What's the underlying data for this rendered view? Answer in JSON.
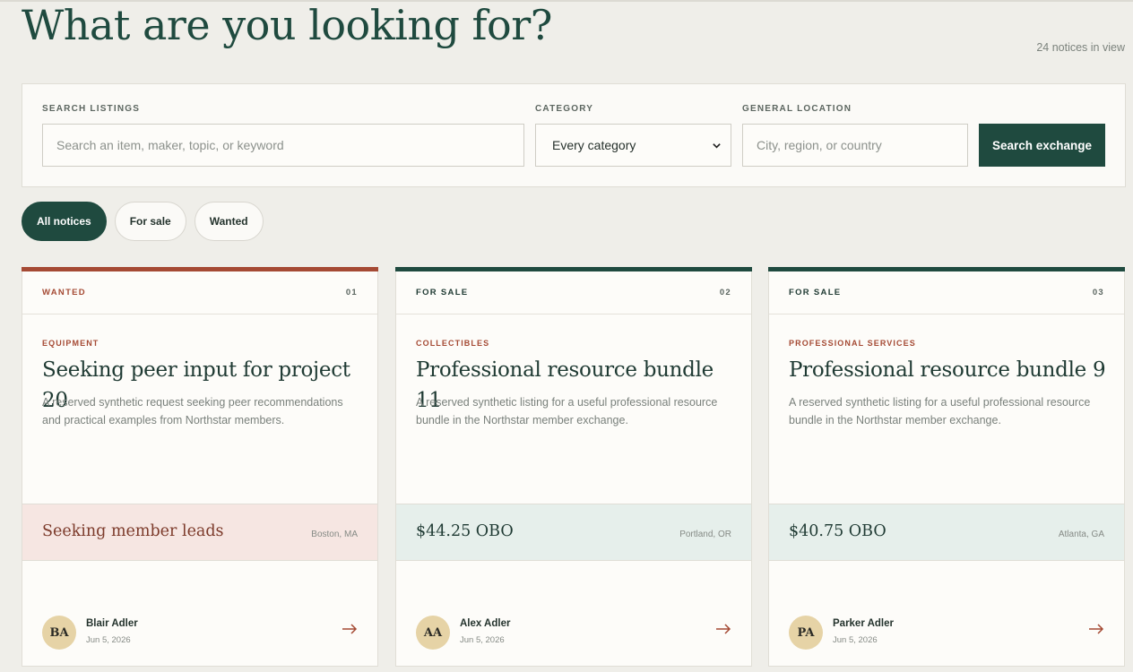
{
  "page": {
    "title": "What are you looking for?",
    "notice_count": "24 notices in view"
  },
  "search": {
    "keyword_label": "SEARCH LISTINGS",
    "keyword_placeholder": "Search an item, maker, topic, or keyword",
    "category_label": "CATEGORY",
    "category_value": "Every category",
    "location_label": "GENERAL LOCATION",
    "location_placeholder": "City, region, or country",
    "button_label": "Search exchange"
  },
  "filters": [
    {
      "label": "All notices",
      "active": true
    },
    {
      "label": "For sale",
      "active": false
    },
    {
      "label": "Wanted",
      "active": false
    }
  ],
  "cards": [
    {
      "type": "WANTED",
      "number": "01",
      "category": "EQUIPMENT",
      "title": "Seeking peer input for project 20",
      "description": "A reserved synthetic request seeking peer recommendations and practical examples from Northstar members.",
      "price": "Seeking member leads",
      "location": "Boston, MA",
      "initials": "BA",
      "author": "Blair Adler",
      "date": "Jun 5, 2026"
    },
    {
      "type": "FOR SALE",
      "number": "02",
      "category": "COLLECTIBLES",
      "title": "Professional resource bundle 11",
      "description": "A reserved synthetic listing for a useful professional resource bundle in the Northstar member exchange.",
      "price": "$44.25 OBO",
      "location": "Portland, OR",
      "initials": "AA",
      "author": "Alex Adler",
      "date": "Jun 5, 2026"
    },
    {
      "type": "FOR SALE",
      "number": "03",
      "category": "PROFESSIONAL SERVICES",
      "title": "Professional resource bundle 9",
      "description": "A reserved synthetic listing for a useful professional resource bundle in the Northstar member exchange.",
      "price": "$40.75 OBO",
      "location": "Atlanta, GA",
      "initials": "PA",
      "author": "Parker Adler",
      "date": "Jun 5, 2026"
    }
  ],
  "colors": {
    "brand_green": "#1f4a3f",
    "wanted_red": "#a54a34",
    "wanted_band": "#f6e6e2",
    "sale_band": "#e6efeb",
    "avatar_bg": "#e6d3a6"
  }
}
